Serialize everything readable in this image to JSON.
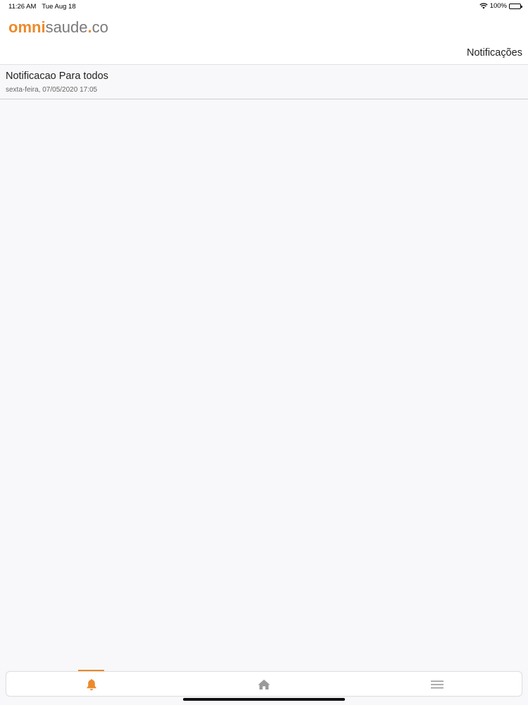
{
  "status_bar": {
    "time": "11:26 AM",
    "date": "Tue Aug 18",
    "battery": "100%"
  },
  "header": {
    "logo": {
      "omni": "omni",
      "saude": "saude",
      "dot": ".",
      "co": "co"
    },
    "title": "Notificações"
  },
  "notifications": [
    {
      "title": "Notificacao Para todos",
      "date": "sexta-feira, 07/05/2020 17:05"
    }
  ],
  "tab_bar": {
    "active_tab": "notifications",
    "tabs": [
      {
        "id": "notifications",
        "icon": "bell-icon",
        "color": "#ec8a2a"
      },
      {
        "id": "home",
        "icon": "home-icon",
        "color": "#9a9a9a"
      },
      {
        "id": "menu",
        "icon": "menu-icon",
        "color": "#9a9a9a"
      }
    ]
  },
  "colors": {
    "accent": "#ec8a2a",
    "inactive_icon": "#9a9a9a",
    "background": "#f8f8fa"
  }
}
